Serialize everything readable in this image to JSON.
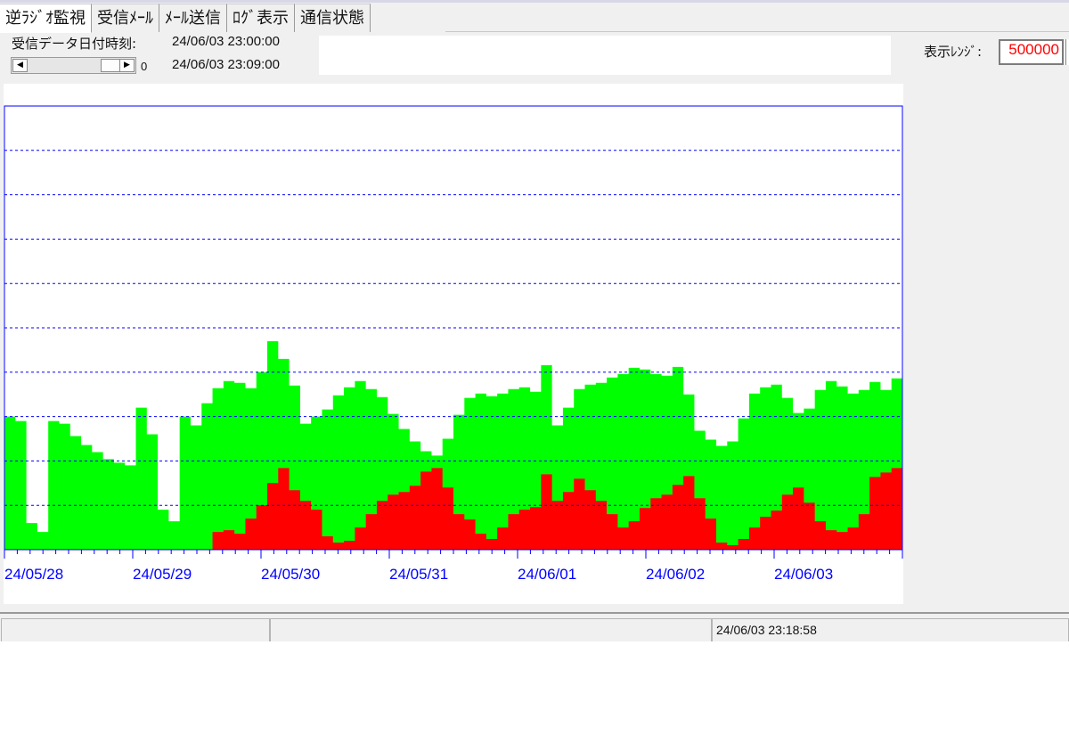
{
  "tabs": [
    {
      "label": "逆ﾗｼﾞｵ監視",
      "active": true
    },
    {
      "label": "受信ﾒｰﾙ",
      "active": false
    },
    {
      "label": "ﾒｰﾙ送信",
      "active": false
    },
    {
      "label": "ﾛｸﾞ表示",
      "active": false
    },
    {
      "label": "通信状態",
      "active": false
    }
  ],
  "header": {
    "received_label": "受信データ日付時刻:",
    "time_from": "24/06/03 23:00:00",
    "time_to": "24/06/03 23:09:00",
    "scroll_value": "0",
    "range_label": "表示ﾚﾝｼﾞ:",
    "range_value": "500000"
  },
  "status": {
    "panel1": "",
    "panel2": "",
    "datetime": "24/06/03 23:18:58"
  },
  "colors": {
    "series_green": "#00ff00",
    "series_red": "#ff0000",
    "axis": "#0000ff",
    "range_text": "#ff0000"
  },
  "chart_data": {
    "type": "area",
    "x_tick_labels": [
      "24/05/28",
      "24/05/29",
      "24/05/30",
      "24/05/31",
      "24/06/01",
      "24/06/02",
      "24/06/03"
    ],
    "ylim": [
      0,
      500000
    ],
    "y_gridlines": 9,
    "grid": true,
    "series": [
      {
        "color": "#00ff00",
        "values": [
          150000,
          145000,
          30000,
          20000,
          145000,
          142000,
          128000,
          118000,
          110000,
          102000,
          98000,
          95000,
          160000,
          130000,
          45000,
          32000,
          150000,
          140000,
          165000,
          182000,
          190000,
          188000,
          182000,
          200000,
          235000,
          215000,
          185000,
          142000,
          150000,
          158000,
          174000,
          183000,
          190000,
          181000,
          172000,
          153000,
          136000,
          122000,
          111000,
          106000,
          125000,
          152000,
          171000,
          176000,
          173000,
          176000,
          181000,
          183000,
          178000,
          208000,
          140000,
          160000,
          181000,
          186000,
          188000,
          194000,
          198000,
          205000,
          203000,
          198000,
          196000,
          206000,
          175000,
          134000,
          124000,
          117000,
          122000,
          148000,
          176000,
          183000,
          186000,
          171000,
          154000,
          159000,
          180000,
          190000,
          184000,
          176000,
          180000,
          189000,
          180000,
          193000
        ]
      },
      {
        "color": "#ff0000",
        "values": [
          0,
          0,
          0,
          0,
          0,
          0,
          0,
          0,
          0,
          0,
          0,
          0,
          0,
          0,
          0,
          0,
          0,
          0,
          0,
          20000,
          22000,
          18000,
          35000,
          50000,
          75000,
          92000,
          67000,
          55000,
          45000,
          15000,
          8000,
          10000,
          25000,
          40000,
          55000,
          62000,
          65000,
          72000,
          88000,
          92000,
          70000,
          40000,
          34000,
          18000,
          12000,
          25000,
          40000,
          45000,
          48000,
          85000,
          55000,
          65000,
          80000,
          67000,
          55000,
          40000,
          25000,
          32000,
          47000,
          58000,
          62000,
          73000,
          83000,
          58000,
          35000,
          8000,
          5000,
          12000,
          25000,
          37000,
          44000,
          62000,
          70000,
          53000,
          32000,
          22000,
          20000,
          25000,
          40000,
          82000,
          87000,
          92000
        ]
      }
    ]
  }
}
